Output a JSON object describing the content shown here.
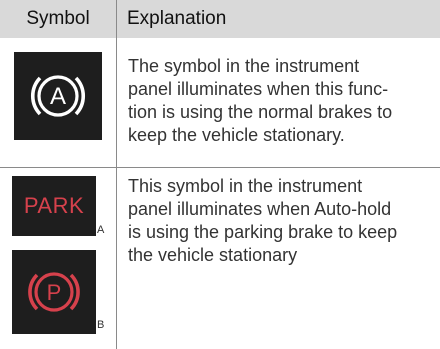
{
  "table": {
    "header": {
      "symbol": "Symbol",
      "explanation": "Explanation"
    },
    "rows": [
      {
        "icon": "auto-hold-icon",
        "icon_letter": "A",
        "text_lines": [
          "The symbol in the instrument",
          "panel illuminates when this func-",
          "tion is using the normal brakes to",
          "keep the vehicle stationary."
        ]
      },
      {
        "icons": [
          {
            "name": "park-brake-text-icon",
            "text": "PARK",
            "tag": "A"
          },
          {
            "name": "park-brake-circle-icon",
            "letter": "P",
            "tag": "B"
          }
        ],
        "text_lines": [
          "This symbol in the instrument",
          "panel illuminates when Auto-hold",
          "is using the parking brake to keep",
          "the vehicle stationary"
        ]
      }
    ]
  },
  "colors": {
    "header_bg": "#d9d9d9",
    "icon_bg": "#1e1e1e",
    "auto_icon": "#ffffff",
    "park_icon": "#d6414c"
  }
}
